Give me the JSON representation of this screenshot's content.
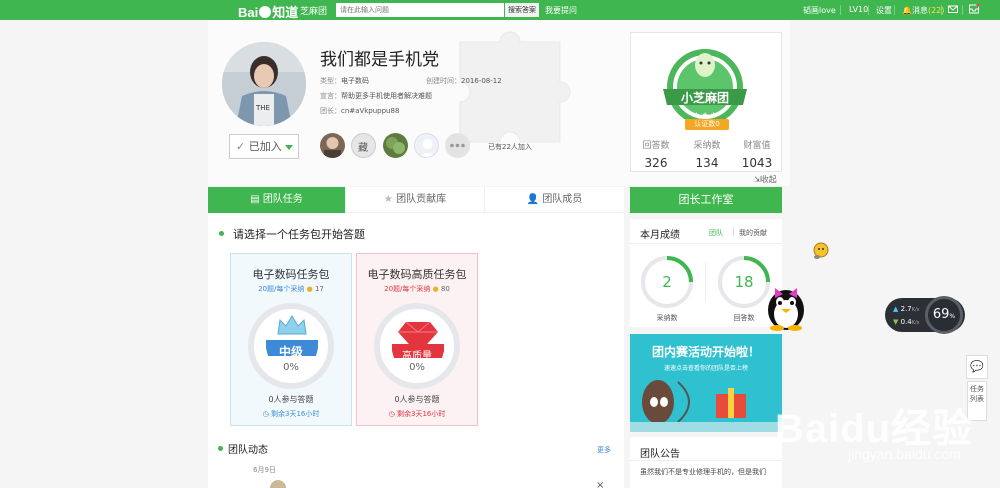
{
  "topbar": {
    "logo_bai": "Bai",
    "logo_zhidao": "知道",
    "channel": "芝麻团",
    "search_placeholder": "请在此输入问题",
    "search_button": "搜索答案",
    "ask_button": "我要提问",
    "username": "韬画love",
    "level": "LV10",
    "settings": "设置",
    "messages_label": "消息",
    "messages_count": "(22)"
  },
  "group": {
    "name": "我们都是手机党",
    "type_label": "类型：",
    "type_value": "电子数码",
    "created_label": "创建时间：",
    "created_value": "2016-08-12",
    "motto_label": "宣言：",
    "motto_value": "帮助更多手机使用者解决难题",
    "leader_label": "团长：",
    "leader_value": "cn#aVkpuppu88",
    "join_button": "已加入",
    "joined_count": "已有22人加入",
    "badge_text": "小芝麻团",
    "certified": "认证数0",
    "stats": [
      {
        "label": "回答数",
        "value": "326"
      },
      {
        "label": "采纳数",
        "value": "134"
      },
      {
        "label": "财富值",
        "value": "1043"
      }
    ],
    "collapse": "收起"
  },
  "tabs": [
    {
      "label": "团队任务",
      "active": true
    },
    {
      "label": "团队贡献库",
      "active": false
    },
    {
      "label": "团队成员",
      "active": false
    }
  ],
  "tasks": {
    "heading": "请选择一个任务包开始答题",
    "cards": [
      {
        "title": "电子数码任务包",
        "subtitle": "20题/每个采纳",
        "reward": "17",
        "level": "中级",
        "percent": "0%",
        "participants": "0人参与答题",
        "remaining": "剩余3天16小时"
      },
      {
        "title": "电子数码高质任务包",
        "subtitle": "20题/每个采纳",
        "reward": "80",
        "level": "高质量",
        "percent": "0%",
        "participants": "0人参与答题",
        "remaining": "剩余3天16小时"
      }
    ]
  },
  "news": {
    "heading": "团队动态",
    "more": "更多",
    "date": "6月9日"
  },
  "leader_panel": {
    "title": "团长工作室",
    "month_label": "本月成绩",
    "filter_team": "团队",
    "filter_mine": "我的贡献",
    "adopted_value": "2",
    "adopted_label": "采纳数",
    "answers_value": "18",
    "answers_label": "回答数"
  },
  "banner": {
    "title": "团内赛活动开始啦！",
    "subtitle": "速速点击查看你的团队是否上榜"
  },
  "notice": {
    "title": "团队公告",
    "text": "虽然我们不是专业修理手机的，但是我们"
  },
  "speed": {
    "up": "2.7",
    "down": "0.4",
    "unit": "K/s",
    "percent": "69",
    "percent_unit": "%"
  },
  "side": {
    "chat": "💬",
    "tasks": "任务列表"
  },
  "watermark": {
    "brand": "Baidu经验",
    "url": "jingyan.baidu.com"
  },
  "colors": {
    "brand": "#3fb64f",
    "blue": "#3d8bd8",
    "red": "#e2353d"
  }
}
